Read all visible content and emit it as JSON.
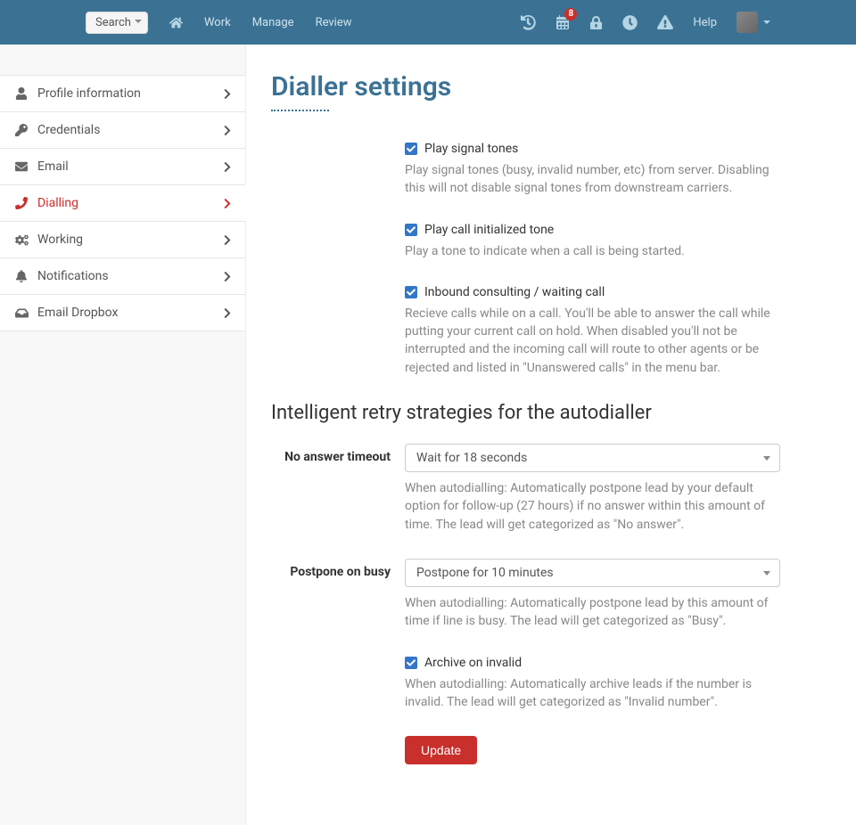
{
  "nav": {
    "search_label": "Search",
    "links": [
      "Work",
      "Manage",
      "Review"
    ],
    "help_label": "Help",
    "badge_count": "8"
  },
  "sidebar": {
    "items": [
      {
        "label": "Profile information"
      },
      {
        "label": "Credentials"
      },
      {
        "label": "Email"
      },
      {
        "label": "Dialling"
      },
      {
        "label": "Working"
      },
      {
        "label": "Notifications"
      },
      {
        "label": "Email Dropbox"
      }
    ]
  },
  "page": {
    "title": "Dialler settings",
    "section_heading": "Intelligent retry strategies for the autodialler"
  },
  "settings": {
    "play_signal": {
      "label": "Play signal tones",
      "help": "Play signal tones (busy, invalid number, etc) from server. Disabling this will not disable signal tones from downstream carriers."
    },
    "play_init": {
      "label": "Play call initialized tone",
      "help": "Play a tone to indicate when a call is being started."
    },
    "inbound": {
      "label": "Inbound consulting / waiting call",
      "help": "Recieve calls while on a call. You'll be able to answer the call while putting your current call on hold. When disabled you'll not be interrupted and the incoming call will route to other agents or be rejected and listed in \"Unanswered calls\" in the menu bar."
    },
    "no_answer": {
      "label": "No answer timeout",
      "value": "Wait for 18 seconds",
      "help": "When autodialling: Automatically postpone lead by your default option for follow-up (27 hours) if no answer within this amount of time. The lead will get categorized as \"No answer\"."
    },
    "postpone_busy": {
      "label": "Postpone on busy",
      "value": "Postpone for 10 minutes",
      "help": "When autodialling: Automatically postpone lead by this amount of time if line is busy. The lead will get categorized as \"Busy\"."
    },
    "archive_invalid": {
      "label": "Archive on invalid",
      "help": "When autodialling: Automatically archive leads if the number is invalid. The lead will get categorized as \"Invalid number\"."
    },
    "update_label": "Update"
  }
}
